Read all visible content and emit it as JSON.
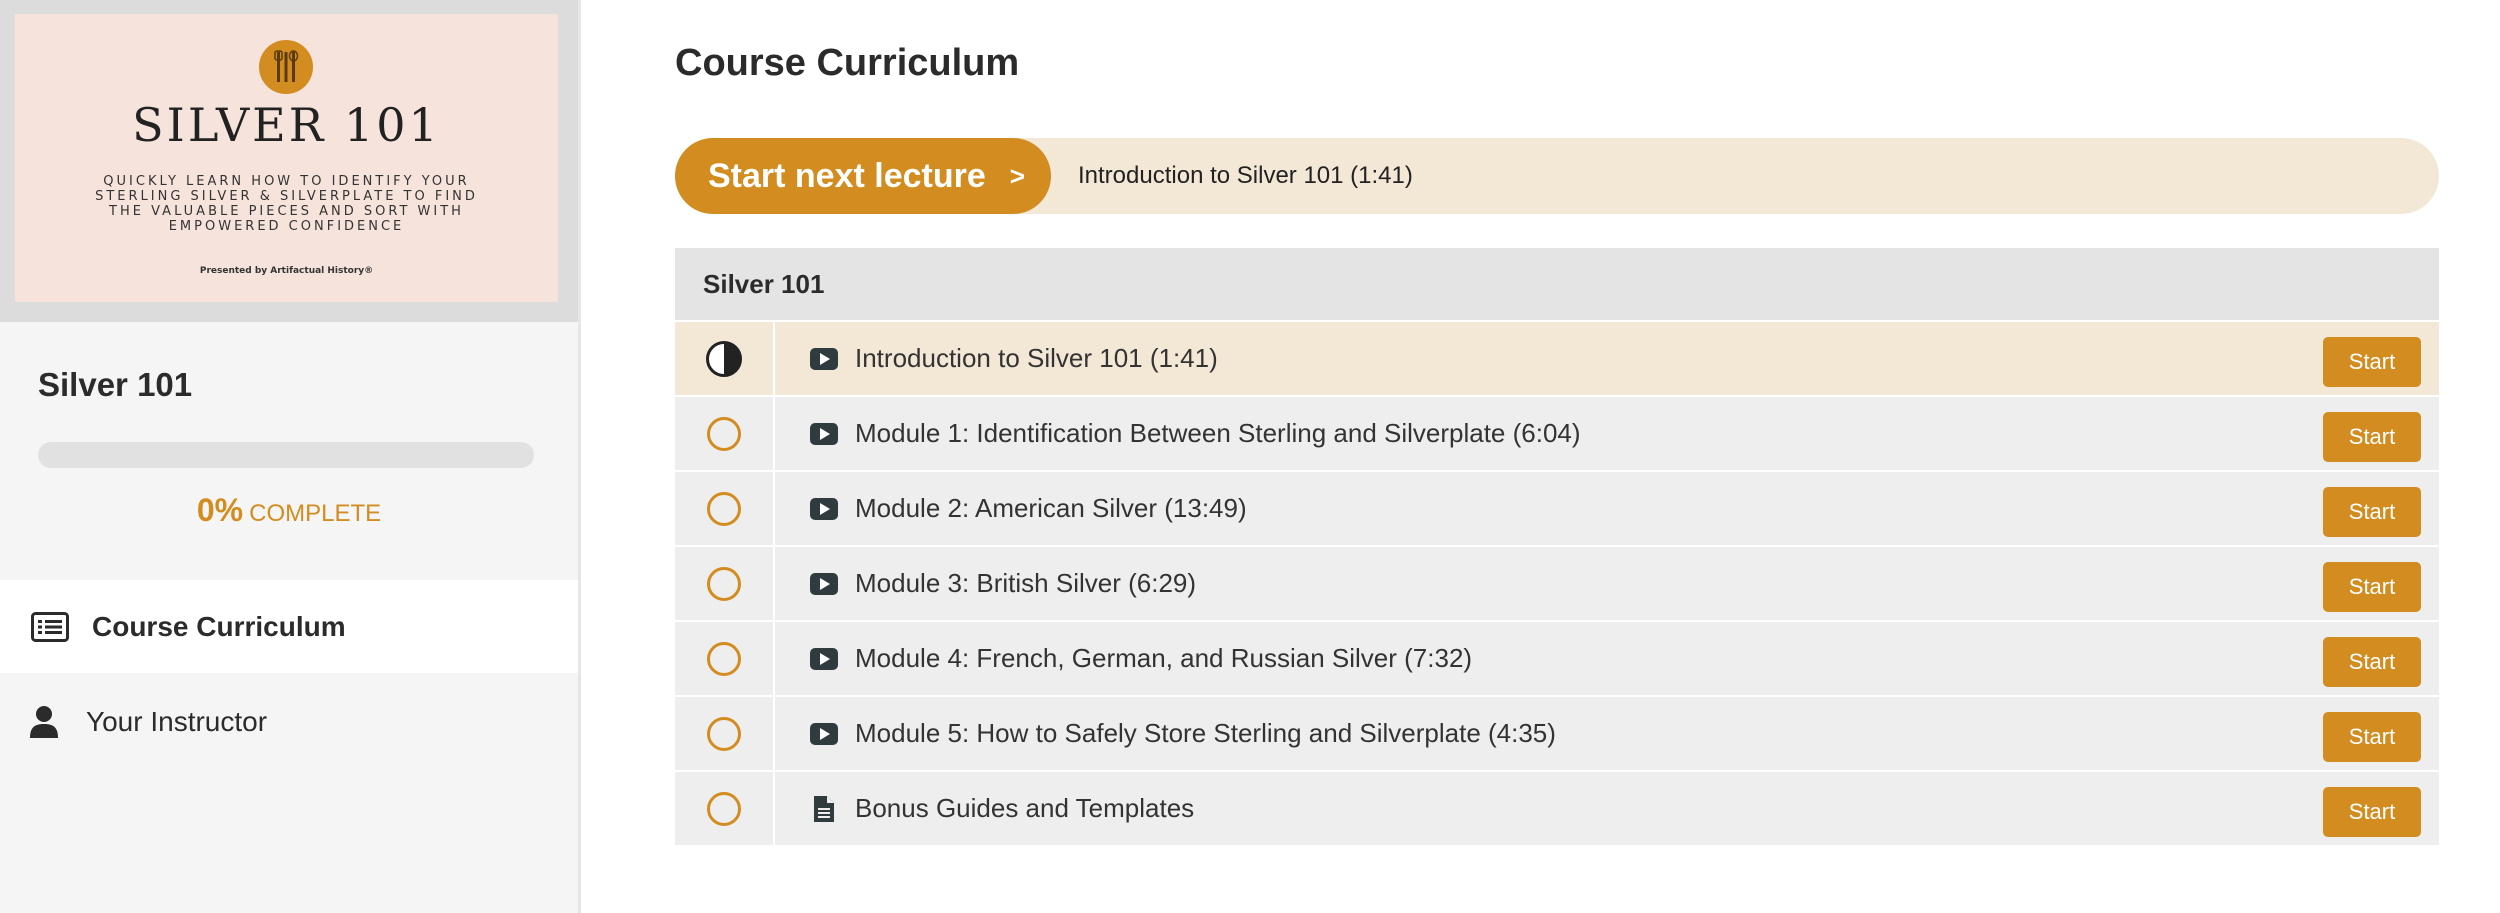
{
  "sidebar": {
    "cover": {
      "title": "SILVER 101",
      "subtitle": "Quickly learn how to identify your sterling silver & silverplate to find the valuable pieces and sort with empowered confidence",
      "presented_by": "Presented by Artifactual History®"
    },
    "course_title": "Silver 101",
    "progress": {
      "percent_value": 0,
      "percent_text": "0%",
      "label": "COMPLETE"
    },
    "nav": [
      {
        "label": "Course Curriculum",
        "icon": "list-icon",
        "active": true
      },
      {
        "label": "Your Instructor",
        "icon": "user-icon",
        "active": false
      }
    ]
  },
  "main": {
    "title": "Course Curriculum",
    "next_lecture": {
      "button_label": "Start next lecture",
      "chevron": ">",
      "lecture_title": "Introduction to Silver 101 (1:41)"
    },
    "section": {
      "title": "Silver 101",
      "lectures": [
        {
          "title": "Introduction to Silver 101 (1:41)",
          "type": "video",
          "status": "in-progress",
          "button": "Start"
        },
        {
          "title": "Module 1: Identification Between Sterling and Silverplate (6:04)",
          "type": "video",
          "status": "not-started",
          "button": "Start"
        },
        {
          "title": "Module 2: American Silver (13:49)",
          "type": "video",
          "status": "not-started",
          "button": "Start"
        },
        {
          "title": "Module 3: British Silver (6:29)",
          "type": "video",
          "status": "not-started",
          "button": "Start"
        },
        {
          "title": "Module 4: French, German, and Russian Silver (7:32)",
          "type": "video",
          "status": "not-started",
          "button": "Start"
        },
        {
          "title": "Module 5: How to Safely Store Sterling and Silverplate (4:35)",
          "type": "video",
          "status": "not-started",
          "button": "Start"
        },
        {
          "title": "Bonus Guides and Templates",
          "type": "document",
          "status": "not-started",
          "button": "Start"
        }
      ]
    }
  },
  "colors": {
    "accent": "#d38c1f",
    "highlight_bg": "#f3e7d6",
    "row_bg": "#eeeeee",
    "cover_bg": "#f6e4dc"
  }
}
